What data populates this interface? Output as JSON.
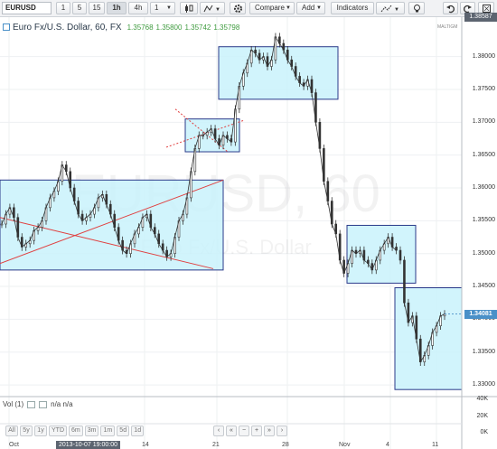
{
  "toolbar": {
    "symbol": "EURUSD",
    "intervals": [
      "1",
      "5",
      "15",
      "1h",
      "4h",
      "1"
    ],
    "compare_label": "Compare",
    "add_label": "Add",
    "indicators_label": "Indicators"
  },
  "header": {
    "title": "Euro Fx/U.S. Dollar, 60, FX",
    "open": "1.35768",
    "high": "1.35800",
    "low": "1.35742",
    "close": "1.35798"
  },
  "watermark_text": "EURUSD, 60",
  "watermark_sub": "Euro Fx/U.S. Dollar",
  "brand_small": "MALTIGM",
  "price_axis": {
    "labels": [
      "1.38000",
      "1.37500",
      "1.37000",
      "1.36500",
      "1.36000",
      "1.35500",
      "1.35000",
      "1.34500",
      "1.34000",
      "1.33500",
      "1.33000"
    ],
    "top_price": "1.38587",
    "last_price": "1.34081"
  },
  "volume": {
    "legend": "Vol (1)",
    "values": "n/a n/a",
    "axis": [
      "40K",
      "20K",
      "0K"
    ]
  },
  "range_buttons": [
    "All",
    "5y",
    "1y",
    "YTD",
    "6m",
    "3m",
    "1m",
    "5d",
    "1d"
  ],
  "nav_buttons": [
    "‹",
    "«",
    "−",
    "+",
    "»",
    "›"
  ],
  "time_axis": {
    "labels": [
      "Oct",
      "14",
      "21",
      "28",
      "Nov",
      "4",
      "11"
    ],
    "crosshair_time": "2013-10-07 19:00:00"
  },
  "colors": {
    "box_fill": "#c9f2fb",
    "box_stroke": "#2a3a8a",
    "trendline": "#e04040",
    "candle": "#333333",
    "last_price": "#4a90c8"
  },
  "chart_data": {
    "type": "candlestick",
    "title": "Euro Fx/U.S. Dollar, 60, FX",
    "ylabel": "",
    "ylim": [
      1.3285,
      1.386
    ],
    "x_ticks": [
      "Oct",
      "14",
      "21",
      "28",
      "Nov",
      "4",
      "11"
    ],
    "series": [
      {
        "name": "EURUSD",
        "values": [
          1.3545,
          1.356,
          1.357,
          1.3555,
          1.3525,
          1.351,
          1.3515,
          1.352,
          1.3535,
          1.354,
          1.355,
          1.357,
          1.3585,
          1.3595,
          1.361,
          1.3635,
          1.3625,
          1.36,
          1.358,
          1.356,
          1.355,
          1.3555,
          1.356,
          1.357,
          1.3585,
          1.359,
          1.3575,
          1.356,
          1.354,
          1.352,
          1.3505,
          1.35,
          1.3515,
          1.353,
          1.354,
          1.3555,
          1.356,
          1.354,
          1.353,
          1.3515,
          1.3505,
          1.3495,
          1.35,
          1.3525,
          1.355,
          1.356,
          1.3585,
          1.3625,
          1.366,
          1.368,
          1.368,
          1.3685,
          1.369,
          1.3675,
          1.3665,
          1.368,
          1.3675,
          1.367,
          1.372,
          1.3755,
          1.3775,
          1.379,
          1.381,
          1.3805,
          1.3795,
          1.38,
          1.3785,
          1.3795,
          1.383,
          1.382,
          1.381,
          1.3795,
          1.3785,
          1.377,
          1.376,
          1.3755,
          1.3765,
          1.3745,
          1.37,
          1.366,
          1.361,
          1.358,
          1.3545,
          1.353,
          1.349,
          1.347,
          1.3485,
          1.3505,
          1.35,
          1.3505,
          1.349,
          1.3485,
          1.3475,
          1.349,
          1.3505,
          1.3515,
          1.3525,
          1.351,
          1.3505,
          1.349,
          1.3425,
          1.3395,
          1.3405,
          1.337,
          1.3335,
          1.3345,
          1.336,
          1.338,
          1.339,
          1.3405,
          1.3408
        ]
      }
    ],
    "annotations": {
      "boxes": [
        {
          "x": [
            0,
            247
          ],
          "y": [
            1.3475,
            1.3612
          ]
        },
        {
          "x": [
            205,
            265
          ],
          "y": [
            1.3655,
            1.3705
          ]
        },
        {
          "x": [
            242,
            374
          ],
          "y": [
            1.3735,
            1.3815
          ]
        },
        {
          "x": [
            384,
            460
          ],
          "y": [
            1.3455,
            1.3543
          ]
        },
        {
          "x": [
            437,
            511
          ],
          "y": [
            1.3293,
            1.3448
          ]
        }
      ]
    }
  }
}
